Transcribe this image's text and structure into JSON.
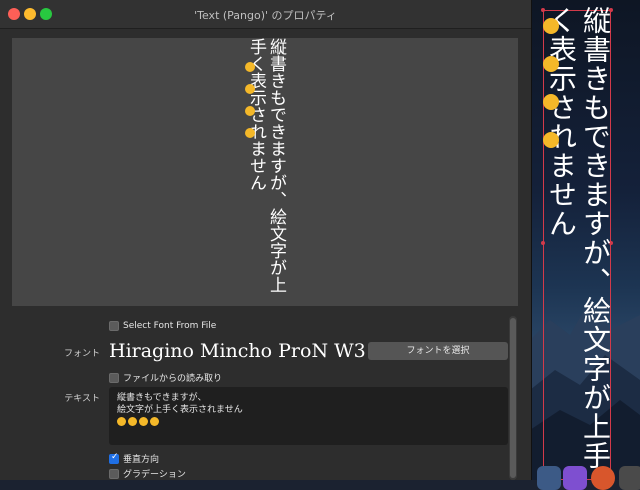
{
  "window": {
    "title": "'Text (Pango)' のプロパティ"
  },
  "preview": {
    "text": "縦書きもできますが、絵文字が上手く表示されません"
  },
  "canvas": {
    "text": "縦書きもできますが、絵文字が上手く表示されません"
  },
  "form": {
    "select_font_from_file": {
      "label": "Select Font From File",
      "checked": false
    },
    "font": {
      "label": "フォント",
      "value": "Hiragino Mincho ProN W3",
      "button": "フォントを選択"
    },
    "read_from_file": {
      "label": "ファイルからの読み取り",
      "checked": false
    },
    "text": {
      "label": "テキスト",
      "line1": "縦書きもできますが、",
      "line2": "絵文字が上手く表示されません"
    },
    "vertical": {
      "label": "垂直方向",
      "checked": true
    },
    "gradient": {
      "label": "グラデーション",
      "checked": false
    }
  },
  "colors": {
    "accent": "#1f6fe5",
    "selection_frame": "#d23a4a",
    "emoji_yellow": "#f4b829"
  }
}
